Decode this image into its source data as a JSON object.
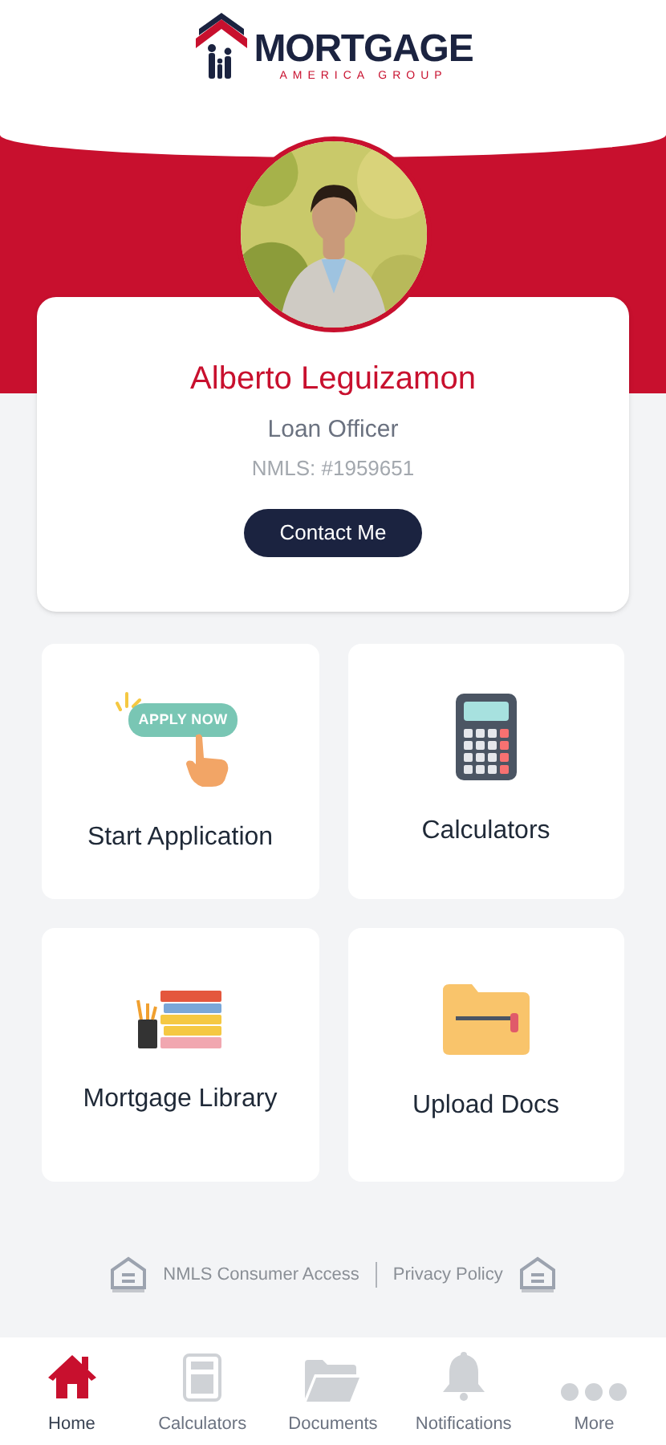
{
  "logo": {
    "title": "MORTGAGE",
    "subtitle": "AMERICA GROUP"
  },
  "profile": {
    "name": "Alberto Leguizamon",
    "role": "Loan Officer",
    "nmls": "NMLS: #1959651",
    "button": "Contact Me"
  },
  "tiles": [
    {
      "kind": "apply",
      "label": "Start Application",
      "badge": "APPLY NOW"
    },
    {
      "kind": "calculator",
      "label": "Calculators"
    },
    {
      "kind": "library",
      "label": "Mortgage Library"
    },
    {
      "kind": "folder",
      "label": "Upload Docs"
    }
  ],
  "footer_links": [
    "NMLS Consumer Access",
    "Privacy Policy"
  ],
  "nav": [
    {
      "kind": "home",
      "label": "Home",
      "selected": true
    },
    {
      "kind": "calculator",
      "label": "Calculators",
      "selected": false
    },
    {
      "kind": "folder",
      "label": "Documents",
      "selected": false
    },
    {
      "kind": "bell",
      "label": "Notifications",
      "selected": false
    },
    {
      "kind": "more",
      "label": "More",
      "selected": false
    }
  ]
}
